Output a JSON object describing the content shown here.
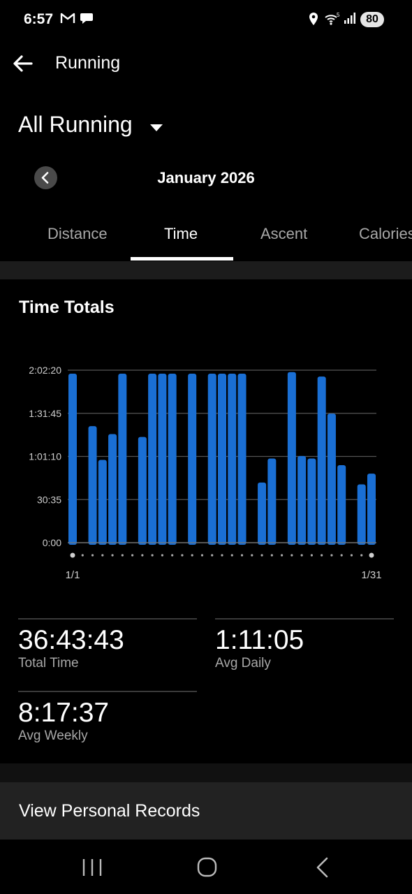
{
  "status_bar": {
    "time": "6:57",
    "battery": "80",
    "icons": [
      "gmail-icon",
      "chat-icon",
      "location-icon",
      "wifi-icon",
      "signal-icon",
      "battery-icon"
    ]
  },
  "appbar": {
    "title": "Running"
  },
  "filter": {
    "label": "All Running"
  },
  "month": {
    "label": "January 2026"
  },
  "tabs": [
    {
      "label": "Distance",
      "active": false
    },
    {
      "label": "Time",
      "active": true
    },
    {
      "label": "Ascent",
      "active": false
    },
    {
      "label": "Calories",
      "active": false
    }
  ],
  "card": {
    "title": "Time Totals"
  },
  "chart_data": {
    "type": "bar",
    "xlabel": "",
    "ylabel": "",
    "y_tick_labels": [
      "0:00",
      "30:35",
      "1:01:10",
      "1:31:45",
      "2:02:20"
    ],
    "y_ticks_seconds": [
      0,
      1835,
      3670,
      5505,
      7340
    ],
    "ylim_seconds": [
      0,
      7340
    ],
    "x_tick_labels": [
      "1/1",
      "1/31"
    ],
    "categories": [
      "1/1",
      "1/2",
      "1/3",
      "1/4",
      "1/5",
      "1/6",
      "1/7",
      "1/8",
      "1/9",
      "1/10",
      "1/11",
      "1/12",
      "1/13",
      "1/14",
      "1/15",
      "1/16",
      "1/17",
      "1/18",
      "1/19",
      "1/20",
      "1/21",
      "1/22",
      "1/23",
      "1/24",
      "1/25",
      "1/26",
      "1/27",
      "1/28",
      "1/29",
      "1/30",
      "1/31"
    ],
    "values_seconds": [
      7190,
      0,
      4960,
      3520,
      4620,
      7190,
      0,
      4500,
      7190,
      7190,
      7190,
      0,
      7190,
      0,
      7190,
      7190,
      7190,
      7190,
      0,
      2560,
      3580,
      0,
      7260,
      3690,
      3580,
      7070,
      5490,
      3300,
      0,
      2480,
      2940
    ],
    "bar_color": "#1a6fd4",
    "grid": true
  },
  "stats": [
    {
      "value": "36:43:43",
      "label": "Total Time"
    },
    {
      "value": "1:11:05",
      "label": "Avg Daily"
    },
    {
      "value": "8:17:37",
      "label": "Avg Weekly"
    }
  ],
  "records": {
    "label": "View Personal Records"
  }
}
